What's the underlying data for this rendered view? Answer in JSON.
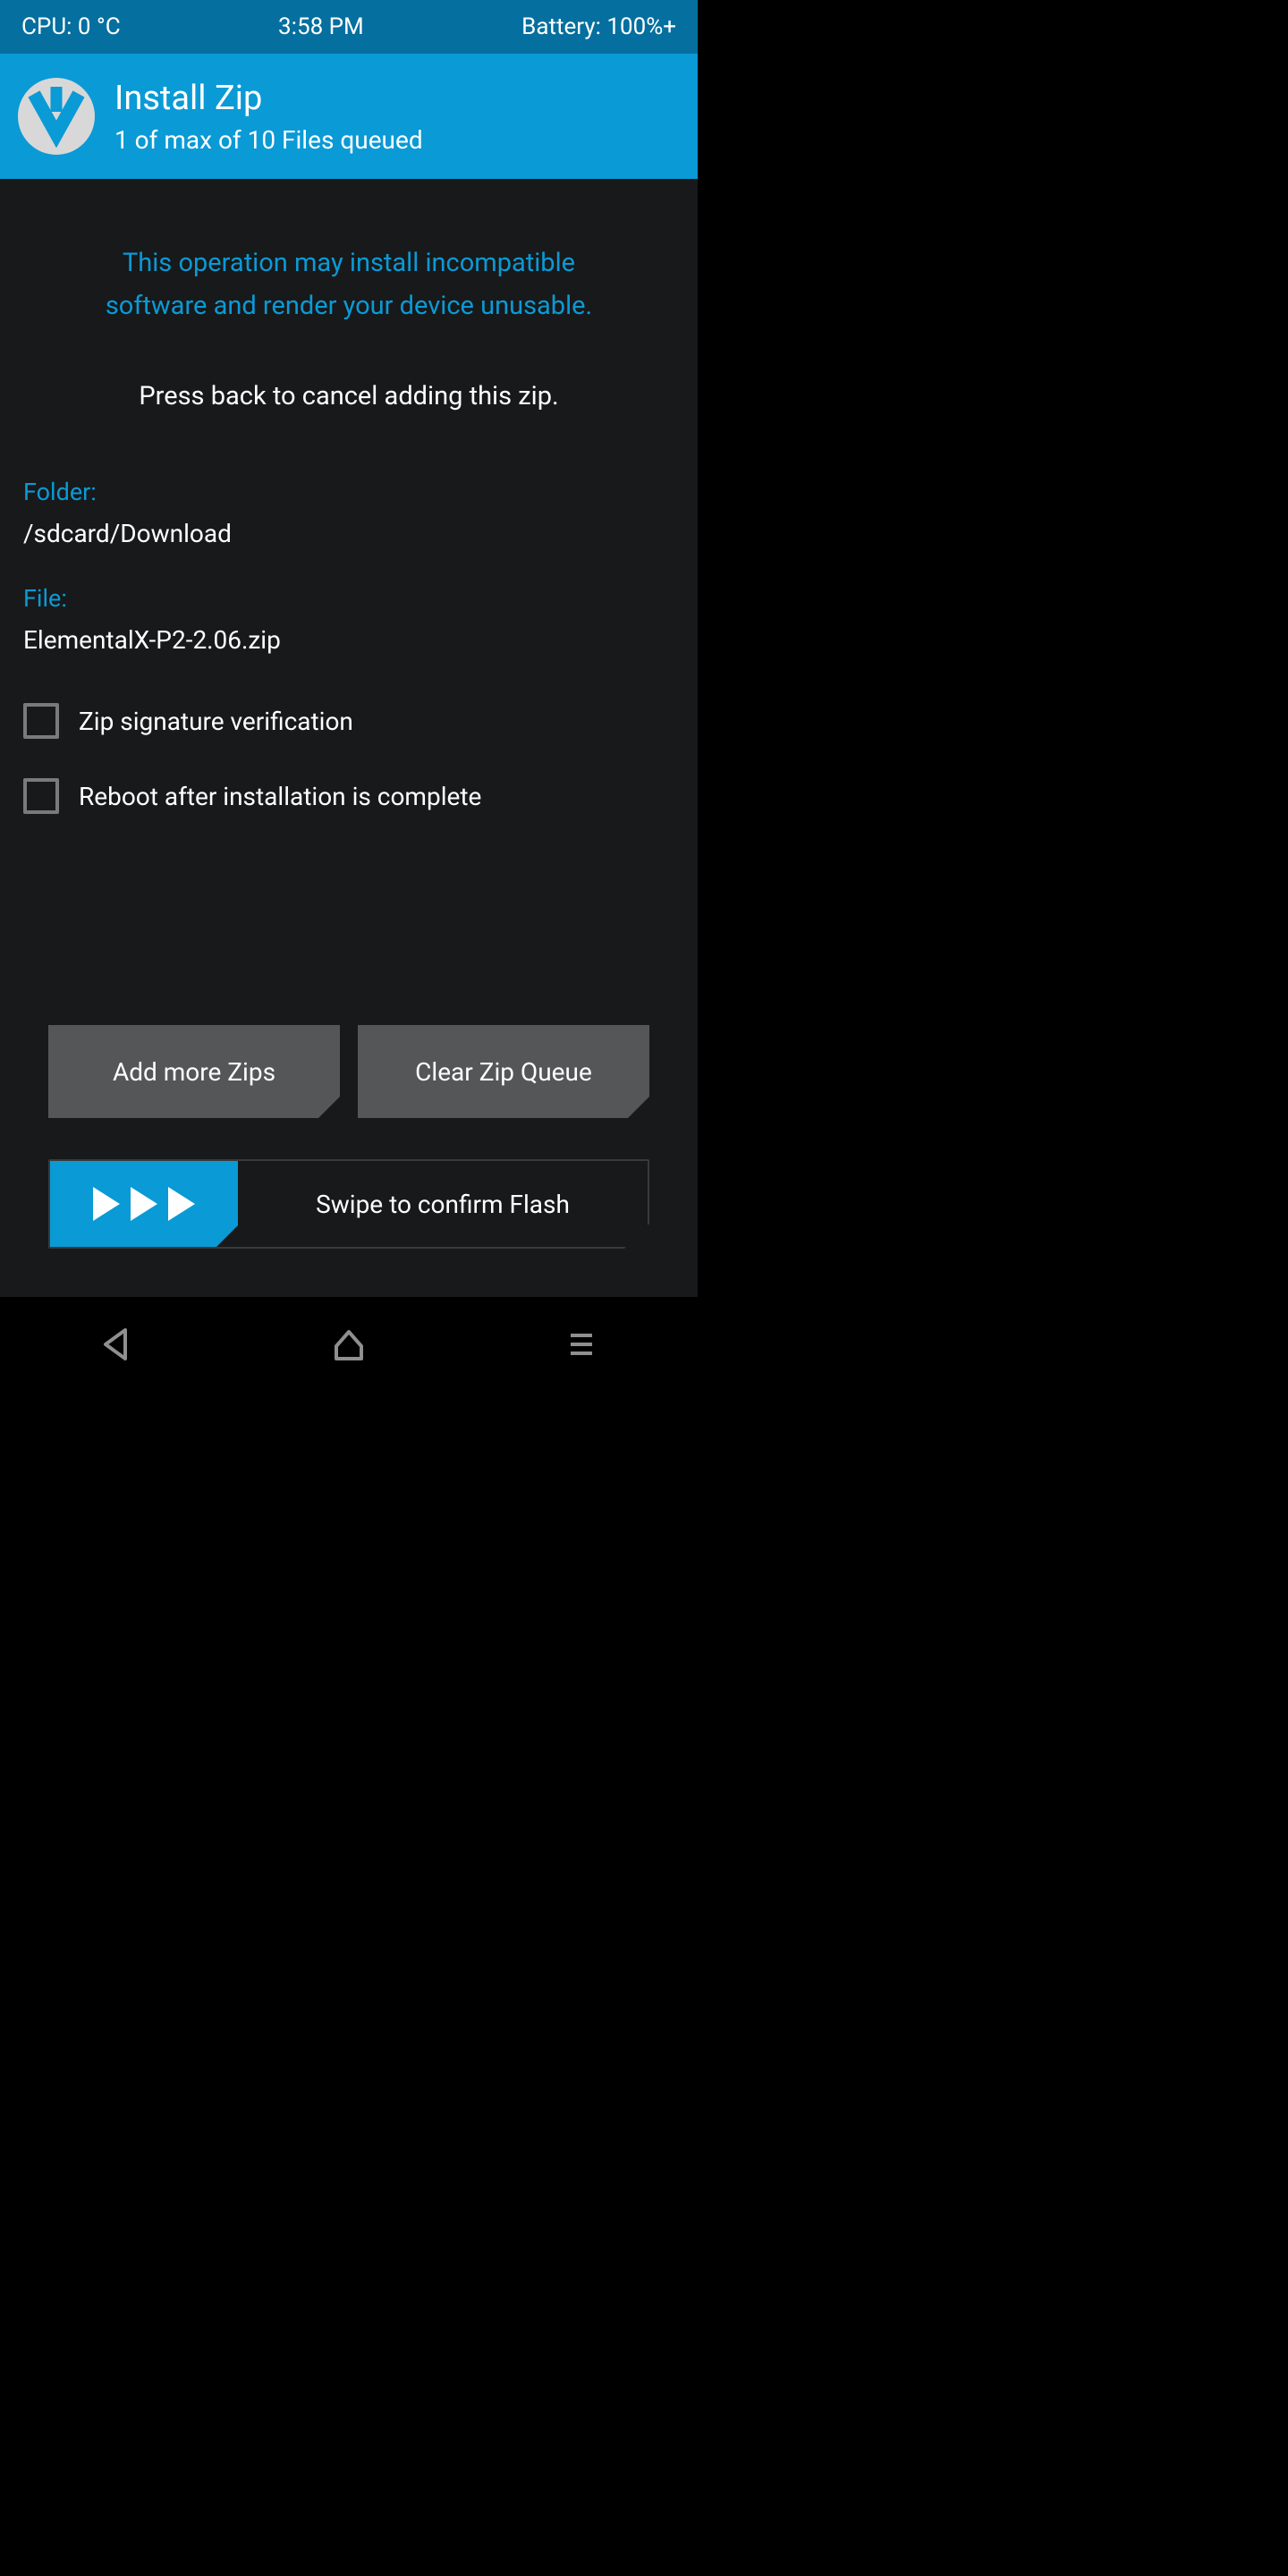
{
  "status": {
    "cpu": "CPU: 0 °C",
    "time": "3:58 PM",
    "battery": "Battery: 100%+"
  },
  "header": {
    "title": "Install Zip",
    "subtitle": "1 of max of 10 Files queued"
  },
  "warning_line1": "This operation may install incompatible",
  "warning_line2": "software and render your device unusable.",
  "press_back": "Press back to cancel adding this zip.",
  "folder_label": "Folder:",
  "folder_value": "/sdcard/Download",
  "file_label": "File:",
  "file_value": "ElementalX-P2-2.06.zip",
  "checkbox1": "Zip signature verification",
  "checkbox2": "Reboot after installation is complete",
  "btn_add": "Add more Zips",
  "btn_clear": "Clear Zip Queue",
  "swipe_label": "Swipe to confirm Flash"
}
